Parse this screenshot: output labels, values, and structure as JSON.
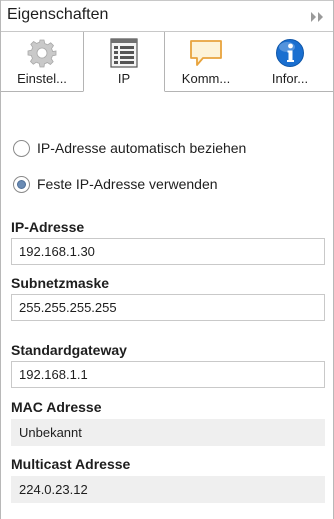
{
  "panel": {
    "title": "Eigenschaften",
    "collapse_icon": "double-chevron-right-icon"
  },
  "tabs": [
    {
      "label": "Einstel...",
      "icon": "gear-icon"
    },
    {
      "label": "IP",
      "icon": "ip-list-icon",
      "active": true
    },
    {
      "label": "Komm...",
      "icon": "speech-bubble-icon"
    },
    {
      "label": "Infor...",
      "icon": "info-icon"
    }
  ],
  "ip_mode": {
    "auto_label": "IP-Adresse automatisch beziehen",
    "fixed_label": "Feste IP-Adresse verwenden",
    "selected": "fixed"
  },
  "fields": {
    "ip_address": {
      "label": "IP-Adresse",
      "value": "192.168.1.30"
    },
    "subnet_mask": {
      "label": "Subnetzmaske",
      "value": "255.255.255.255"
    },
    "gateway": {
      "label": "Standardgateway",
      "value": "192.168.1.1"
    },
    "mac_address": {
      "label": "MAC Adresse",
      "value": "Unbekannt"
    },
    "multicast": {
      "label": "Multicast Adresse",
      "value": "224.0.23.12"
    }
  },
  "colors": {
    "radio_accent": "#6a8bb4",
    "info_blue": "#1a6fd0",
    "bubble_orange": "#e8a33c",
    "readonly_bg": "#efefef"
  }
}
